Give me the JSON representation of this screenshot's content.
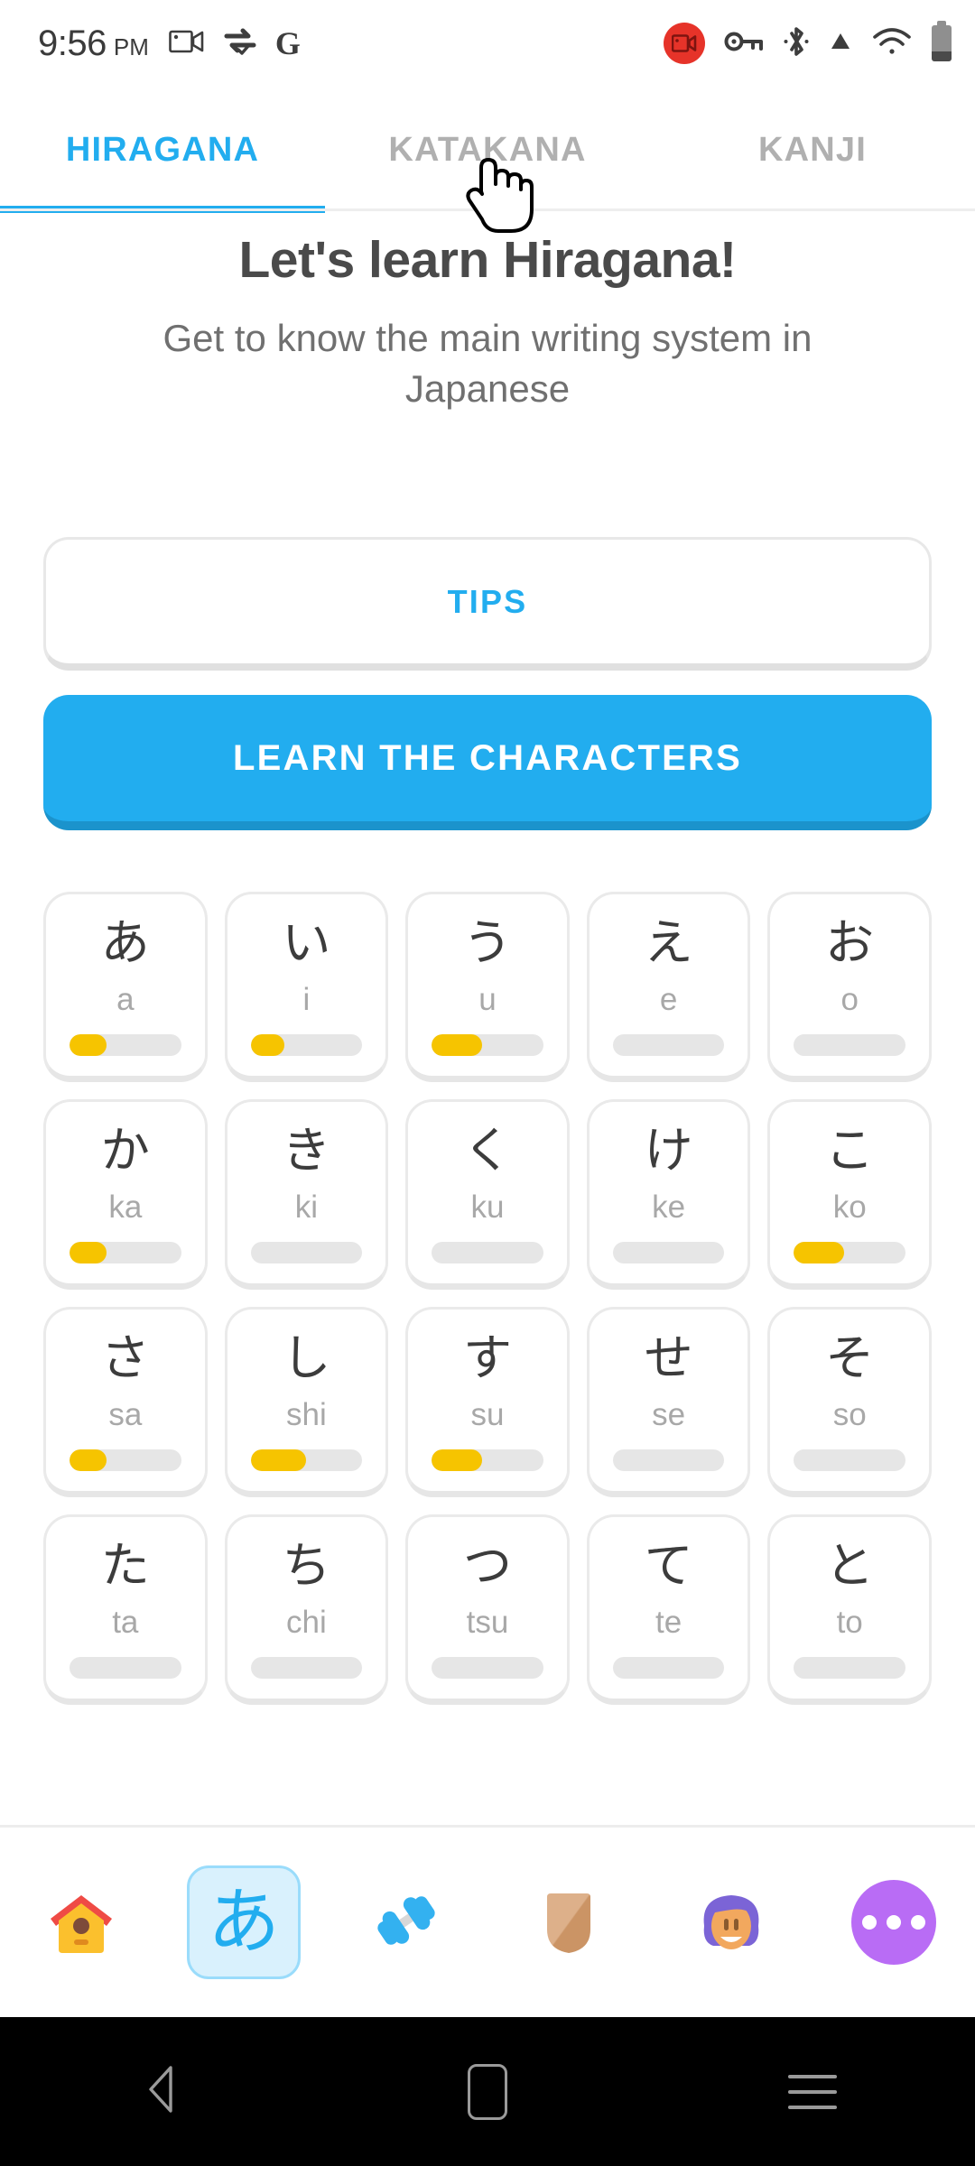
{
  "status_bar": {
    "time": "9:56",
    "ampm": "PM",
    "icons_left": [
      "video-camera-icon",
      "vpn-sync-icon",
      "google-g-icon"
    ],
    "icons_right": [
      "screen-record-icon",
      "vpn-key-icon",
      "bluetooth-icon",
      "signal-triangle-icon",
      "wifi-icon",
      "battery-icon"
    ],
    "google_label": "G"
  },
  "tabs": [
    {
      "label": "HIRAGANA",
      "active": true
    },
    {
      "label": "KATAKANA",
      "active": false
    },
    {
      "label": "KANJI",
      "active": false
    }
  ],
  "hero": {
    "title": "Let's learn Hiragana!",
    "subtitle": "Get to know the main writing system in Japanese"
  },
  "actions": {
    "tips_label": "TIPS",
    "learn_label": "LEARN THE CHARACTERS"
  },
  "colors": {
    "accent_blue": "#22adef",
    "progress_yellow": "#f6c400",
    "progress_track": "#e6e6e6",
    "text_dark": "#4a4a4a",
    "text_muted": "#a8a8a8",
    "record_red": "#e63329",
    "more_purple": "#b96cf5"
  },
  "kana_rows": [
    [
      {
        "char": "あ",
        "romaji": "a",
        "progress": 33
      },
      {
        "char": "い",
        "romaji": "i",
        "progress": 30
      },
      {
        "char": "う",
        "romaji": "u",
        "progress": 45
      },
      {
        "char": "え",
        "romaji": "e",
        "progress": 0
      },
      {
        "char": "お",
        "romaji": "o",
        "progress": 0
      }
    ],
    [
      {
        "char": "か",
        "romaji": "ka",
        "progress": 33
      },
      {
        "char": "き",
        "romaji": "ki",
        "progress": 0
      },
      {
        "char": "く",
        "romaji": "ku",
        "progress": 0
      },
      {
        "char": "け",
        "romaji": "ke",
        "progress": 0
      },
      {
        "char": "こ",
        "romaji": "ko",
        "progress": 45
      }
    ],
    [
      {
        "char": "さ",
        "romaji": "sa",
        "progress": 33
      },
      {
        "char": "し",
        "romaji": "shi",
        "progress": 50
      },
      {
        "char": "す",
        "romaji": "su",
        "progress": 45
      },
      {
        "char": "せ",
        "romaji": "se",
        "progress": 0
      },
      {
        "char": "そ",
        "romaji": "so",
        "progress": 0
      }
    ],
    [
      {
        "char": "た",
        "romaji": "ta",
        "progress": 0
      },
      {
        "char": "ち",
        "romaji": "chi",
        "progress": 0
      },
      {
        "char": "つ",
        "romaji": "tsu",
        "progress": 0
      },
      {
        "char": "て",
        "romaji": "te",
        "progress": 0
      },
      {
        "char": "と",
        "romaji": "to",
        "progress": 0
      }
    ]
  ],
  "bottom_nav": [
    {
      "name": "home",
      "icon": "birdhouse-icon",
      "active": false
    },
    {
      "name": "alphabet",
      "icon": "hiragana-a-icon",
      "active": true,
      "glyph": "あ"
    },
    {
      "name": "practice",
      "icon": "dumbbell-icon",
      "active": false
    },
    {
      "name": "leaderboard",
      "icon": "shield-icon",
      "active": false
    },
    {
      "name": "profile",
      "icon": "avatar-icon",
      "active": false
    },
    {
      "name": "more",
      "icon": "more-dots-icon",
      "active": false
    }
  ],
  "android_nav": [
    {
      "name": "back",
      "icon": "triangle-back-icon"
    },
    {
      "name": "home",
      "icon": "home-rect-icon"
    },
    {
      "name": "recents",
      "icon": "hamburger-recents-icon"
    }
  ]
}
